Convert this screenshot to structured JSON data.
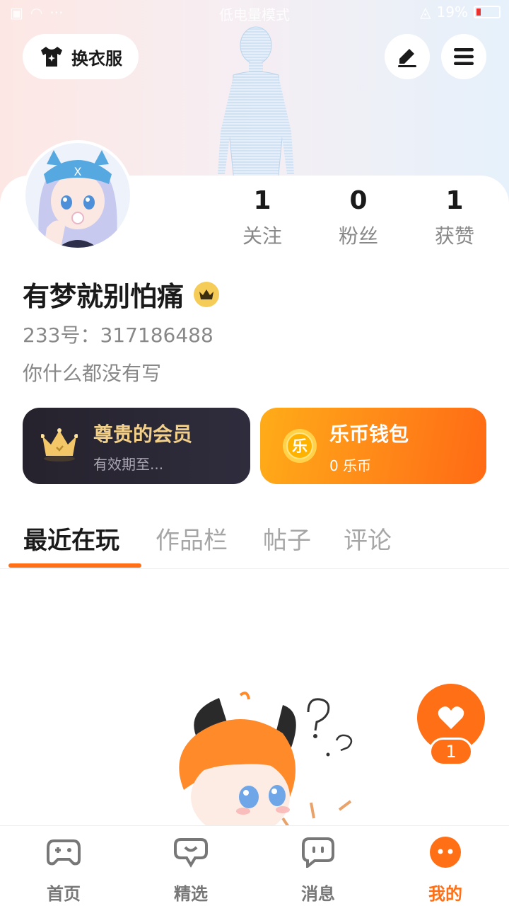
{
  "status_bar": {
    "mode_text": "低电量模式",
    "battery_text": "19%"
  },
  "header": {
    "outfit_label": "换衣服",
    "edit_icon": "pen-icon",
    "menu_icon": "hamburger-menu-icon"
  },
  "profile": {
    "stats": [
      {
        "value": "1",
        "label": "关注"
      },
      {
        "value": "0",
        "label": "粉丝"
      },
      {
        "value": "1",
        "label": "获赞"
      }
    ],
    "username": "有梦就别怕痛",
    "id_text": "233号：317186488",
    "bio": "你什么都没有写"
  },
  "cards": {
    "member": {
      "title": "尊贵的会员",
      "subtitle": "有效期至..."
    },
    "wallet": {
      "title": "乐币钱包",
      "subtitle": "0 乐币",
      "coin_char": "乐"
    }
  },
  "tabs": [
    "最近在玩",
    "作品栏",
    "帖子",
    "评论"
  ],
  "active_tab": "最近在玩",
  "like_fab": {
    "count": "1"
  },
  "bottom_nav": [
    {
      "label": "首页",
      "icon": "gamepad-icon"
    },
    {
      "label": "精选",
      "icon": "heart-bubble-icon"
    },
    {
      "label": "消息",
      "icon": "chat-bubble-icon"
    },
    {
      "label": "我的",
      "icon": "profile-face-icon"
    }
  ],
  "colors": {
    "accent": "#ff6f15",
    "member_gold": "#f3d08a",
    "member_bg": "#26222d"
  }
}
